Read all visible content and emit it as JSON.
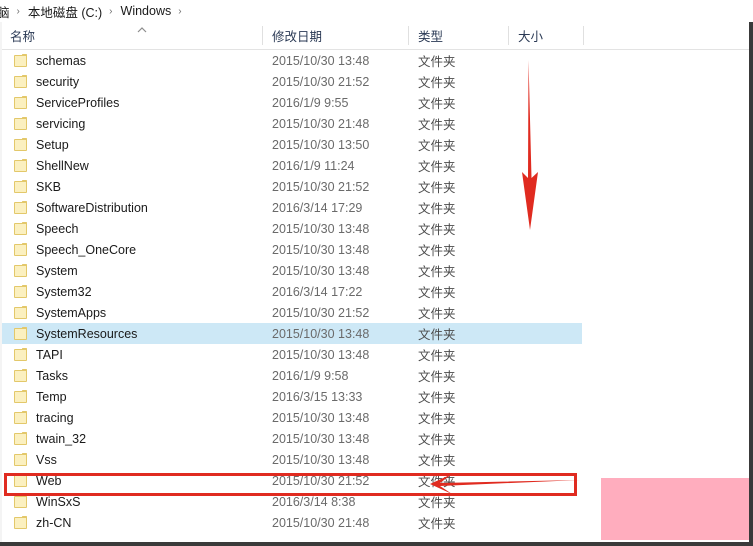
{
  "breadcrumb": {
    "separator": "›",
    "items": [
      "脑",
      "本地磁盘 (C:)",
      "Windows"
    ],
    "trailing_separator": "›"
  },
  "columns": {
    "name": "名称",
    "date_modified": "修改日期",
    "type": "类型",
    "size": "大小",
    "sort_caret": "⌃"
  },
  "files": [
    {
      "name": "schemas",
      "date": "2015/10/30 13:48",
      "type": "文件夹",
      "size": ""
    },
    {
      "name": "security",
      "date": "2015/10/30 21:52",
      "type": "文件夹",
      "size": ""
    },
    {
      "name": "ServiceProfiles",
      "date": "2016/1/9 9:55",
      "type": "文件夹",
      "size": ""
    },
    {
      "name": "servicing",
      "date": "2015/10/30 21:48",
      "type": "文件夹",
      "size": ""
    },
    {
      "name": "Setup",
      "date": "2015/10/30 13:50",
      "type": "文件夹",
      "size": ""
    },
    {
      "name": "ShellNew",
      "date": "2016/1/9 11:24",
      "type": "文件夹",
      "size": ""
    },
    {
      "name": "SKB",
      "date": "2015/10/30 21:52",
      "type": "文件夹",
      "size": ""
    },
    {
      "name": "SoftwareDistribution",
      "date": "2016/3/14 17:29",
      "type": "文件夹",
      "size": ""
    },
    {
      "name": "Speech",
      "date": "2015/10/30 13:48",
      "type": "文件夹",
      "size": ""
    },
    {
      "name": "Speech_OneCore",
      "date": "2015/10/30 13:48",
      "type": "文件夹",
      "size": ""
    },
    {
      "name": "System",
      "date": "2015/10/30 13:48",
      "type": "文件夹",
      "size": ""
    },
    {
      "name": "System32",
      "date": "2016/3/14 17:22",
      "type": "文件夹",
      "size": ""
    },
    {
      "name": "SystemApps",
      "date": "2015/10/30 21:52",
      "type": "文件夹",
      "size": ""
    },
    {
      "name": "SystemResources",
      "date": "2015/10/30 13:48",
      "type": "文件夹",
      "size": "",
      "selected": true
    },
    {
      "name": "TAPI",
      "date": "2015/10/30 13:48",
      "type": "文件夹",
      "size": ""
    },
    {
      "name": "Tasks",
      "date": "2016/1/9 9:58",
      "type": "文件夹",
      "size": ""
    },
    {
      "name": "Temp",
      "date": "2016/3/15 13:33",
      "type": "文件夹",
      "size": ""
    },
    {
      "name": "tracing",
      "date": "2015/10/30 13:48",
      "type": "文件夹",
      "size": ""
    },
    {
      "name": "twain_32",
      "date": "2015/10/30 13:48",
      "type": "文件夹",
      "size": ""
    },
    {
      "name": "Vss",
      "date": "2015/10/30 13:48",
      "type": "文件夹",
      "size": ""
    },
    {
      "name": "Web",
      "date": "2015/10/30 21:52",
      "type": "文件夹",
      "size": "",
      "annotated": true
    },
    {
      "name": "WinSxS",
      "date": "2016/3/14 8:38",
      "type": "文件夹",
      "size": ""
    },
    {
      "name": "zh-CN",
      "date": "2015/10/30 21:48",
      "type": "文件夹",
      "size": ""
    }
  ],
  "annotations": {
    "arrow_color": "#e02b20",
    "box_color": "#e02b20",
    "redaction_color": "#ffadbe",
    "selection_color": "#cde8f6"
  }
}
